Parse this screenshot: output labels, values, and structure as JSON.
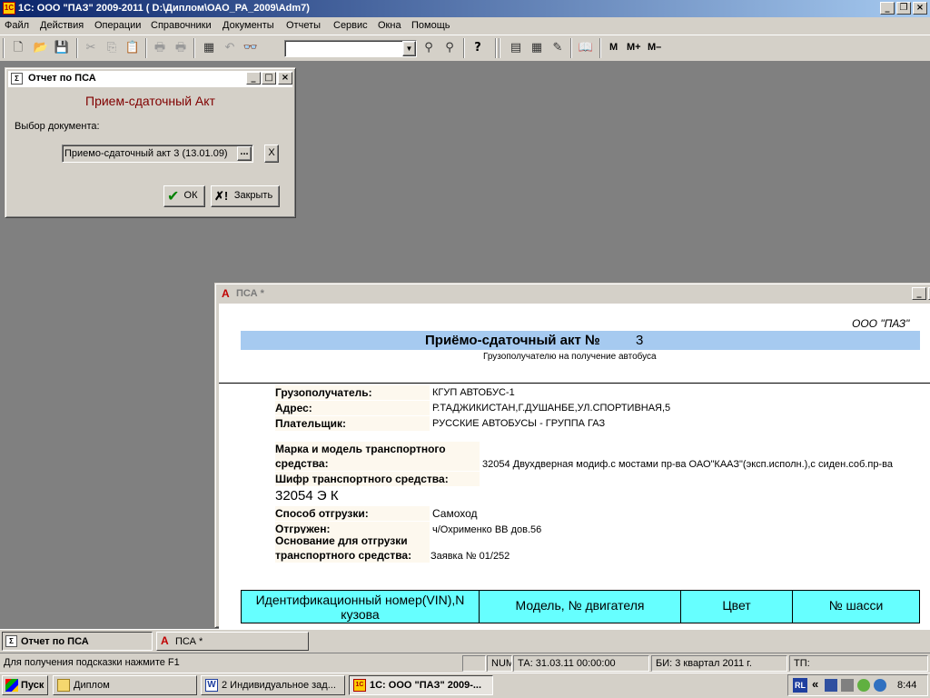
{
  "app": {
    "title": "1С: ООО \"ПАЗ\"  2009-2011 ( D:\\Диплом\\ОАО_РА_2009\\Adm7)",
    "icon": "1c-app-icon",
    "controls": [
      "_",
      "❐",
      "×"
    ]
  },
  "menu": [
    "Файл",
    "Действия",
    "Операции",
    "Справочники",
    "Документы",
    "Отчеты",
    "Сервис",
    "Окна",
    "Помощь"
  ],
  "toolbar": {
    "combo_value": "",
    "m_buttons": [
      "M",
      "M+",
      "M–"
    ]
  },
  "dialog": {
    "title": "Отчет по ПСА",
    "heading": "Прием-сдаточный Акт",
    "heading_color": "#800000",
    "choose_label": "Выбор документа:",
    "doc_value": "Приемо-сдаточный акт 3 (13.01.09)",
    "browse_label": "...",
    "clear_label": "X",
    "ok_label": "ОК",
    "close_label": "Закрыть"
  },
  "doc": {
    "title": "ПСА  *",
    "org": "ООО \"ПАЗ\"",
    "act_title": "Приёмо-сдаточный акт №",
    "act_number": "3",
    "subtitle": "Грузополучателю на получение автобуса",
    "header_band_color": "#a6caf0",
    "fields": {
      "consignee_label": "Грузополучатель:",
      "consignee_value": "КГУП АВТОБУС-1",
      "address_label": "Адрес:",
      "address_value": "Р.ТАДЖИКИСТАН,Г.ДУШАНБЕ,УЛ.СПОРТИВНАЯ,5",
      "payer_label": "Плательщик:",
      "payer_value": "РУССКИЕ АВТОБУСЫ - ГРУППА ГАЗ",
      "model_label_1": "Марка и модель транспортного",
      "model_label_2": "средства:",
      "model_value": "32054 Двухдверная модиф.с мостами пр-ва ОАО\"КААЗ\"(эксп.исполн.),с сиден.соб.пр-ва",
      "code_label": "Шифр транспортного средства:",
      "code_value": "32054 Э К",
      "shipment_label": "Способ отгрузки:",
      "shipment_value": "Самоход",
      "shipped_label": "Отгружен:",
      "shipped_value": "ч/Охрименко ВВ дов.56",
      "basis_label_1": "Основание для отгрузки",
      "basis_label_2": "транспортного средства:",
      "basis_value": "Заявка № 01/252"
    },
    "table_headers": [
      "Идентификационный номер(VIN),N кузова",
      "Модель, № двигателя",
      "Цвет",
      "№ шасси"
    ]
  },
  "window_tabs": [
    "Отчет по ПСА",
    "ПСА  *"
  ],
  "status": {
    "hint": "Для получения подсказки нажмите F1",
    "num": "NUM",
    "ta": "ТА: 31.03.11  00:00:00",
    "bi": "БИ: 3 квартал 2011 г.",
    "tp": "ТП:"
  },
  "taskbar": {
    "start": "Пуск",
    "tasks": [
      "Диплом",
      "2 Индивидуальное зад...",
      "1С: ООО \"ПАЗ\"  2009-..."
    ],
    "lang": "RL",
    "clock": "8:44"
  }
}
